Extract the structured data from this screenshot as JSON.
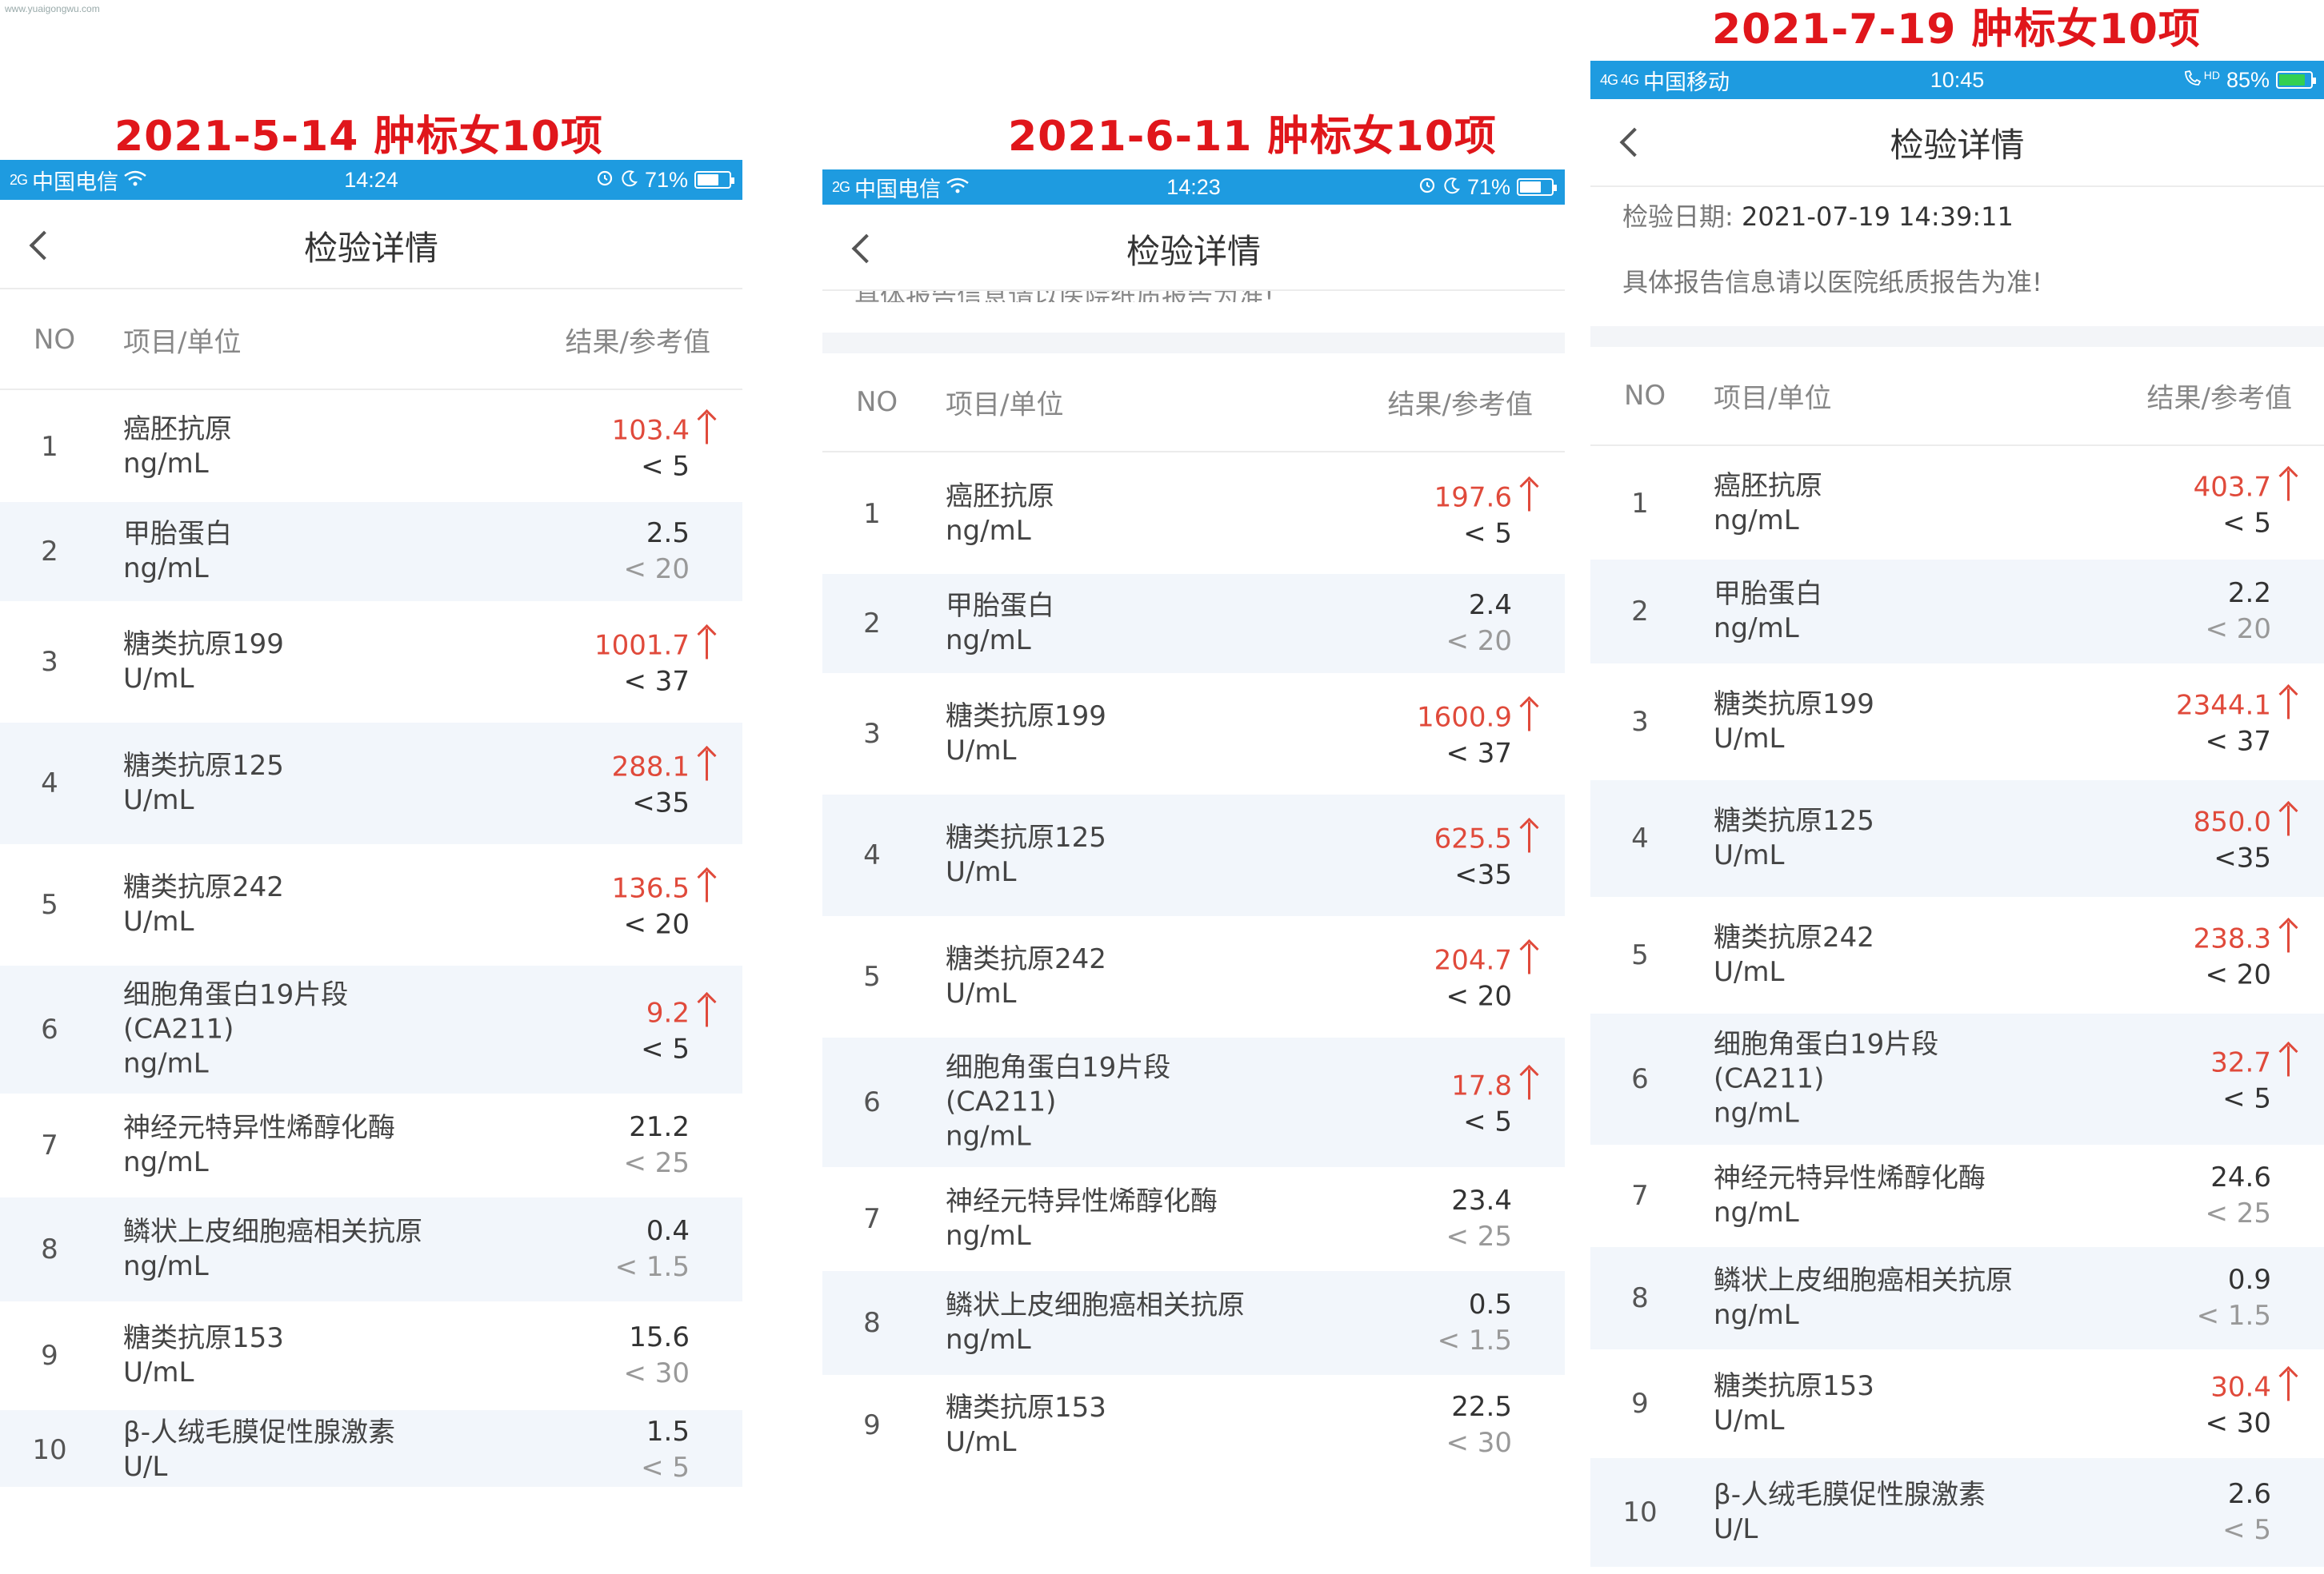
{
  "watermark": "www.yuaigongwu.com",
  "colors": {
    "status_bar": "#1e9be0",
    "caption": "#e0161b",
    "high": "#e04a3b",
    "row_alt": "#f2f6fb"
  },
  "screens": [
    {
      "caption": "2021-5-14 肿标女10项",
      "status": {
        "signal": "2G",
        "carrier": "中国电信",
        "time": "14:24",
        "battery": "71%",
        "battery_level": 0.71
      },
      "nav_title": "检验详情",
      "header": {
        "no": "NO",
        "item": "项目/单位",
        "result": "结果/参考值"
      },
      "rows": [
        {
          "no": "1",
          "name": "癌胚抗原",
          "unit": "ng/mL",
          "result": "103.4",
          "ref": "< 5",
          "high": true
        },
        {
          "no": "2",
          "name": "甲胎蛋白",
          "unit": "ng/mL",
          "result": "2.5",
          "ref": "< 20",
          "high": false
        },
        {
          "no": "3",
          "name": "糖类抗原199",
          "unit": "U/mL",
          "result": "1001.7",
          "ref": "< 37",
          "high": true
        },
        {
          "no": "4",
          "name": "糖类抗原125",
          "unit": "U/mL",
          "result": "288.1",
          "ref": "<35",
          "high": true
        },
        {
          "no": "5",
          "name": "糖类抗原242",
          "unit": "U/mL",
          "result": "136.5",
          "ref": "< 20",
          "high": true
        },
        {
          "no": "6",
          "name": "细胞角蛋白19片段",
          "name2": "(CA211)",
          "unit": "ng/mL",
          "result": "9.2",
          "ref": "< 5",
          "high": true
        },
        {
          "no": "7",
          "name": "神经元特异性烯醇化酶",
          "unit": "ng/mL",
          "result": "21.2",
          "ref": "< 25",
          "high": false
        },
        {
          "no": "8",
          "name": "鳞状上皮细胞癌相关抗原",
          "unit": "ng/mL",
          "result": "0.4",
          "ref": "< 1.5",
          "high": false
        },
        {
          "no": "9",
          "name": "糖类抗原153",
          "unit": "U/mL",
          "result": "15.6",
          "ref": "< 30",
          "high": false
        },
        {
          "no": "10",
          "name": "β-人绒毛膜促性腺激素",
          "unit": "U/L",
          "result": "1.5",
          "ref": "< 5",
          "high": false
        }
      ]
    },
    {
      "caption": "2021-6-11 肿标女10项",
      "status": {
        "signal": "2G",
        "carrier": "中国电信",
        "time": "14:23",
        "battery": "71%",
        "battery_level": 0.71
      },
      "nav_title": "检验详情",
      "notice_cut": "具体报告信息请以医院纸质报告为准!",
      "header": {
        "no": "NO",
        "item": "项目/单位",
        "result": "结果/参考值"
      },
      "rows": [
        {
          "no": "1",
          "name": "癌胚抗原",
          "unit": "ng/mL",
          "result": "197.6",
          "ref": "< 5",
          "high": true
        },
        {
          "no": "2",
          "name": "甲胎蛋白",
          "unit": "ng/mL",
          "result": "2.4",
          "ref": "< 20",
          "high": false
        },
        {
          "no": "3",
          "name": "糖类抗原199",
          "unit": "U/mL",
          "result": "1600.9",
          "ref": "< 37",
          "high": true
        },
        {
          "no": "4",
          "name": "糖类抗原125",
          "unit": "U/mL",
          "result": "625.5",
          "ref": "<35",
          "high": true
        },
        {
          "no": "5",
          "name": "糖类抗原242",
          "unit": "U/mL",
          "result": "204.7",
          "ref": "< 20",
          "high": true
        },
        {
          "no": "6",
          "name": "细胞角蛋白19片段",
          "name2": "(CA211)",
          "unit": "ng/mL",
          "result": "17.8",
          "ref": "< 5",
          "high": true
        },
        {
          "no": "7",
          "name": "神经元特异性烯醇化酶",
          "unit": "ng/mL",
          "result": "23.4",
          "ref": "< 25",
          "high": false
        },
        {
          "no": "8",
          "name": "鳞状上皮细胞癌相关抗原",
          "unit": "ng/mL",
          "result": "0.5",
          "ref": "< 1.5",
          "high": false
        },
        {
          "no": "9",
          "name": "糖类抗原153",
          "unit": "U/mL",
          "result": "22.5",
          "ref": "< 30",
          "high": false
        }
      ]
    },
    {
      "caption": "2021-7-19 肿标女10项",
      "status": {
        "signal": "4G 4G",
        "carrier": "中国移动",
        "time": "10:45",
        "hd": "HD",
        "battery": "85%",
        "battery_level": 0.85
      },
      "nav_title": "检验详情",
      "date_label": "检验日期:",
      "date_value": "2021-07-19 14:39:11",
      "notice": "具体报告信息请以医院纸质报告为准!",
      "header": {
        "no": "NO",
        "item": "项目/单位",
        "result": "结果/参考值"
      },
      "rows": [
        {
          "no": "1",
          "name": "癌胚抗原",
          "unit": "ng/mL",
          "result": "403.7",
          "ref": "< 5",
          "high": true
        },
        {
          "no": "2",
          "name": "甲胎蛋白",
          "unit": "ng/mL",
          "result": "2.2",
          "ref": "< 20",
          "high": false
        },
        {
          "no": "3",
          "name": "糖类抗原199",
          "unit": "U/mL",
          "result": "2344.1",
          "ref": "< 37",
          "high": true
        },
        {
          "no": "4",
          "name": "糖类抗原125",
          "unit": "U/mL",
          "result": "850.0",
          "ref": "<35",
          "high": true
        },
        {
          "no": "5",
          "name": "糖类抗原242",
          "unit": "U/mL",
          "result": "238.3",
          "ref": "< 20",
          "high": true
        },
        {
          "no": "6",
          "name": "细胞角蛋白19片段",
          "name2": "(CA211)",
          "unit": "ng/mL",
          "result": "32.7",
          "ref": "< 5",
          "high": true
        },
        {
          "no": "7",
          "name": "神经元特异性烯醇化酶",
          "unit": "ng/mL",
          "result": "24.6",
          "ref": "< 25",
          "high": false
        },
        {
          "no": "8",
          "name": "鳞状上皮细胞癌相关抗原",
          "unit": "ng/mL",
          "result": "0.9",
          "ref": "< 1.5",
          "high": false
        },
        {
          "no": "9",
          "name": "糖类抗原153",
          "unit": "U/mL",
          "result": "30.4",
          "ref": "< 30",
          "high": true
        },
        {
          "no": "10",
          "name": "β-人绒毛膜促性腺激素",
          "unit": "U/L",
          "result": "2.6",
          "ref": "< 5",
          "high": false
        }
      ]
    }
  ]
}
